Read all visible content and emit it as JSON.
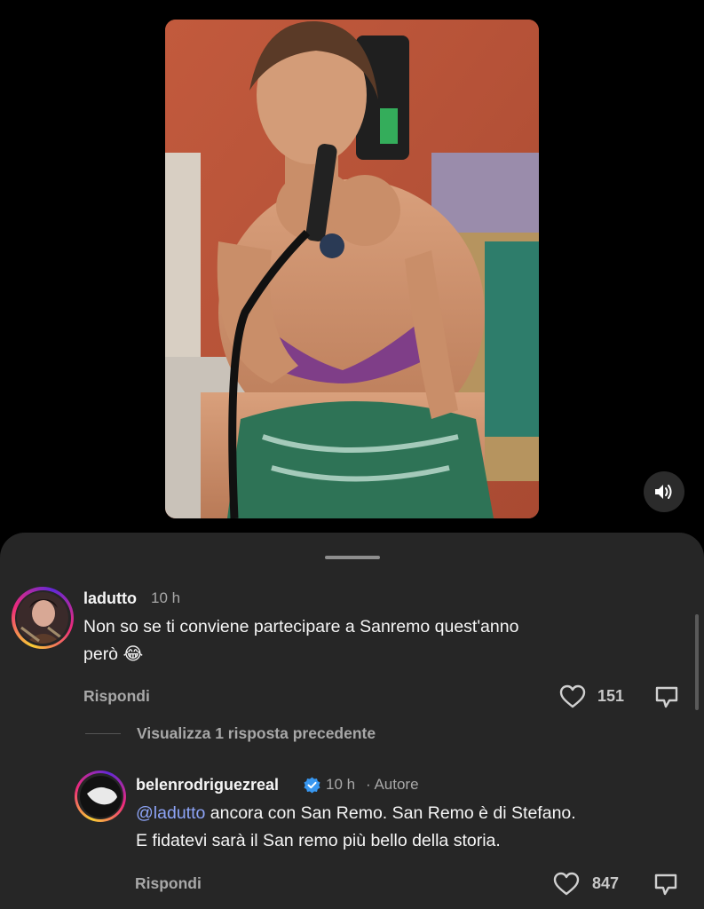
{
  "video": {
    "mute_icon": "speaker-icon"
  },
  "comments": [
    {
      "username": "ladutto",
      "time": "10 h",
      "text": "Non so se ti conviene partecipare a Sanremo quest'anno",
      "text_line2": "però 😂",
      "reply_label": "Rispondi",
      "likes": "151"
    }
  ],
  "view_previous_replies": "Visualizza 1 risposta precedente",
  "reply": {
    "username": "belenrodriguezreal",
    "time": "10 h",
    "author_badge": "· Autore",
    "mention": "@ladutto",
    "text_line1": " ancora con San Remo. San Remo è di Stefano.",
    "text_line2": "E fidatevi sarà il San remo più bello della storia.",
    "reply_label": "Rispondi",
    "likes": "847",
    "verified_color": "#3897f0"
  }
}
